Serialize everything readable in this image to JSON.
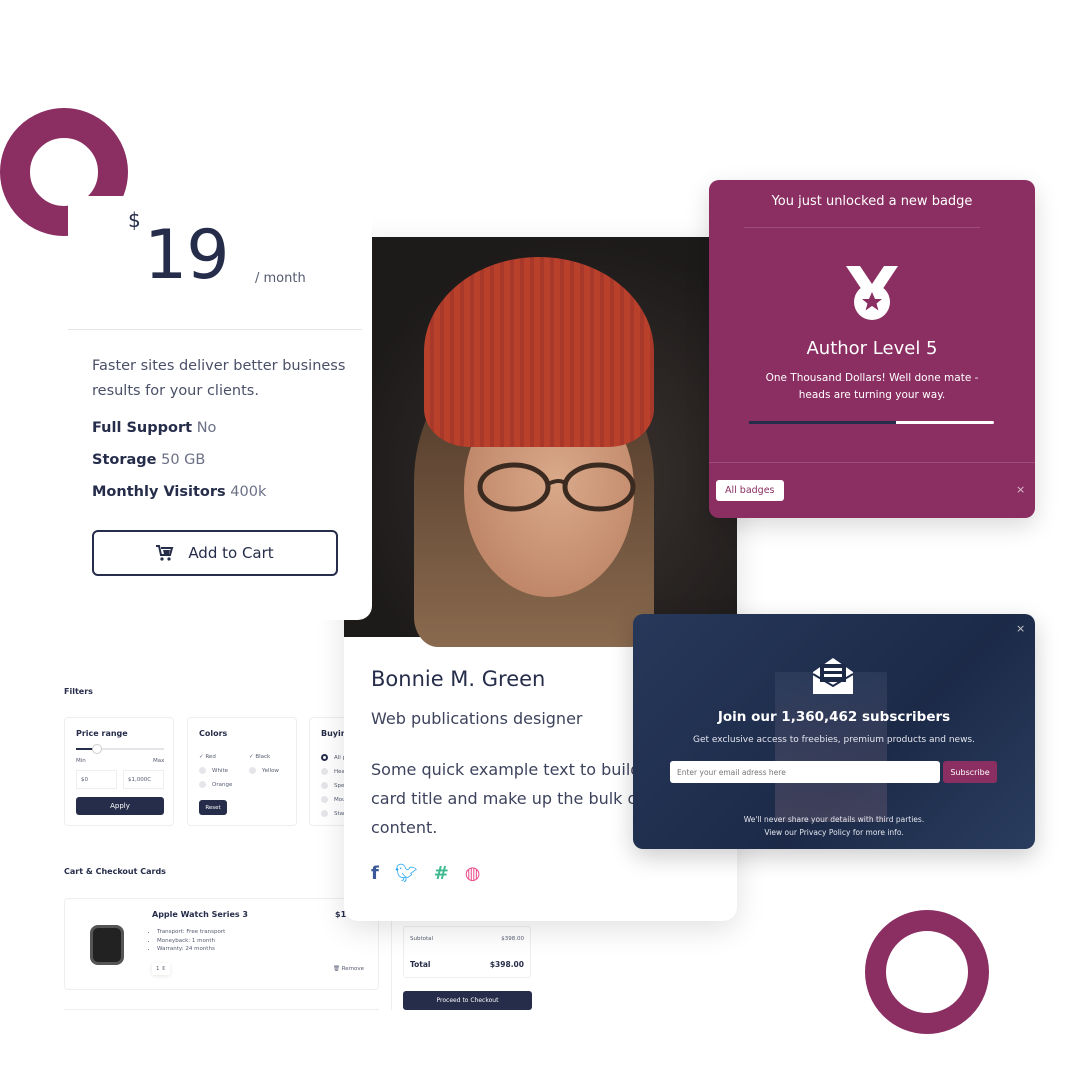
{
  "pricing": {
    "currency": "$",
    "amount": "19",
    "period": "/ month",
    "description": "Faster sites deliver better business results for your clients.",
    "features": [
      {
        "label": "Full Support",
        "value": "No"
      },
      {
        "label": "Storage",
        "value": "50 GB"
      },
      {
        "label": "Monthly Visitors",
        "value": "400k"
      }
    ],
    "cta": "Add to Cart"
  },
  "profile": {
    "name": "Bonnie M. Green",
    "role": "Web publications designer",
    "text": "Some quick example text to build on the card title and make up the bulk of the card's content.",
    "social": [
      "facebook-icon",
      "twitter-icon",
      "slack-icon",
      "dribbble-icon"
    ]
  },
  "badge": {
    "heading": "You just unlocked a new badge",
    "title": "Author Level 5",
    "text": "One Thousand Dollars! Well done mate - heads are turning your way.",
    "progress_percent": 60,
    "button": "All badges",
    "close": "×"
  },
  "subscribe": {
    "close": "×",
    "title": "Join our 1,360,462 subscribers",
    "subtitle": "Get exclusive access to freebies, premium products and news.",
    "placeholder": "Enter your email adress here",
    "button": "Subscribe",
    "note1": "We'll never share your details with third parties.",
    "note2_pre": "View our ",
    "note2_link": "Privacy Policy",
    "note2_post": " for more info."
  },
  "filters": {
    "heading": "Filters",
    "price": {
      "title": "Price range",
      "min_label": "Min",
      "max_label": "Max",
      "min": "$0",
      "max": "$1,000C",
      "apply": "Apply"
    },
    "colors": {
      "title": "Colors",
      "items": [
        {
          "label": "Red",
          "checked": true
        },
        {
          "label": "Black",
          "checked": true
        },
        {
          "label": "White",
          "checked": false
        },
        {
          "label": "Yellow",
          "checked": false
        },
        {
          "label": "Orange",
          "checked": false
        }
      ],
      "reset": "Reset"
    },
    "buying": {
      "title": "Buying",
      "items": [
        "All p",
        "Hea",
        "Spe",
        "Mou",
        "Star"
      ]
    }
  },
  "cart": {
    "heading": "Cart & Checkout Cards",
    "product": "Apple Watch Series 3",
    "price": "$1",
    "bullets": [
      "Transport: Free transport",
      "Moneyback: 1 month",
      "Warranty: 24 months"
    ],
    "qty": "1 ⇕",
    "remove": "Remove",
    "subtotal_label": "Subtotal",
    "subtotal": "$398.00",
    "total_label": "Total",
    "total": "$398.00",
    "checkout": "Proceed to Checkout"
  },
  "colors": {
    "brand": "#8b2e62",
    "navy": "#262d4a"
  }
}
